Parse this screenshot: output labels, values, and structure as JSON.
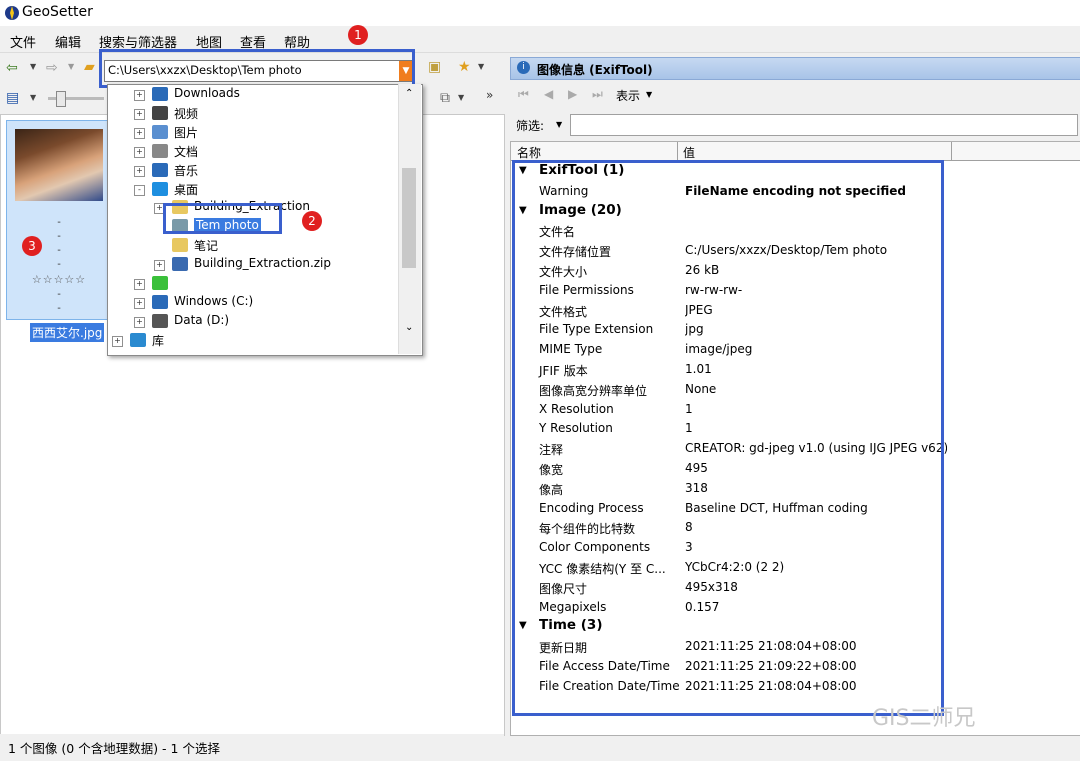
{
  "window": {
    "title": "GeoSetter"
  },
  "menu": [
    "文件",
    "编辑",
    "搜索与筛选器",
    "地图",
    "查看",
    "帮助"
  ],
  "path_combo": {
    "value": "C:\\Users\\xxzx\\Desktop\\Tem photo"
  },
  "annotations": [
    "1",
    "2",
    "3"
  ],
  "tree": [
    {
      "label": "Downloads",
      "indent": 1,
      "expander": "+"
    },
    {
      "label": "视频",
      "indent": 1,
      "expander": "+"
    },
    {
      "label": "图片",
      "indent": 1,
      "expander": "+"
    },
    {
      "label": "文档",
      "indent": 1,
      "expander": "+"
    },
    {
      "label": "音乐",
      "indent": 1,
      "expander": "+"
    },
    {
      "label": "桌面",
      "indent": 1,
      "expander": "-"
    },
    {
      "label": "Building_Extraction",
      "indent": 2,
      "expander": "+"
    },
    {
      "label": "Tem photo",
      "indent": 2,
      "expander": "",
      "selected": true
    },
    {
      "label": "笔记",
      "indent": 2,
      "expander": ""
    },
    {
      "label": "Building_Extraction.zip",
      "indent": 2,
      "expander": "+"
    },
    {
      "label": "",
      "indent": 1,
      "expander": "+"
    },
    {
      "label": "Windows (C:)",
      "indent": 1,
      "expander": "+"
    },
    {
      "label": "Data (D:)",
      "indent": 1,
      "expander": "+"
    },
    {
      "label": "库",
      "indent": 0,
      "expander": "+"
    }
  ],
  "thumbnail": {
    "lines": [
      "-",
      "-",
      "-",
      "-",
      "-",
      "-"
    ],
    "stars": "☆☆☆☆☆",
    "file_name": "西西艾尔.jpg"
  },
  "status": {
    "text": "1 个图像 (0 个含地理数据) - 1 个选择"
  },
  "info_panel": {
    "title": "图像信息 (ExifTool)",
    "display_label": "表示",
    "filter_label": "筛选:",
    "col_name": "名称",
    "col_value": "值",
    "rows": [
      {
        "group": true,
        "name": "ExifTool (1)"
      },
      {
        "name": "Warning",
        "value": "FileName encoding not specified",
        "bold": true
      },
      {
        "group": true,
        "name": "Image (20)"
      },
      {
        "name": "文件名",
        "value": ""
      },
      {
        "name": "文件存储位置",
        "value": "C:/Users/xxzx/Desktop/Tem photo"
      },
      {
        "name": "文件大小",
        "value": "26 kB"
      },
      {
        "name": "File Permissions",
        "value": "rw-rw-rw-"
      },
      {
        "name": "文件格式",
        "value": "JPEG"
      },
      {
        "name": "File Type Extension",
        "value": "jpg"
      },
      {
        "name": "MIME Type",
        "value": "image/jpeg"
      },
      {
        "name": "JFIF 版本",
        "value": "1.01"
      },
      {
        "name": "图像高宽分辨率单位",
        "value": "None"
      },
      {
        "name": "X Resolution",
        "value": "1"
      },
      {
        "name": "Y Resolution",
        "value": "1"
      },
      {
        "name": "注释",
        "value": "CREATOR: gd-jpeg v1.0 (using IJG JPEG v62),..."
      },
      {
        "name": "像宽",
        "value": "495"
      },
      {
        "name": "像高",
        "value": "318"
      },
      {
        "name": "Encoding Process",
        "value": "Baseline DCT, Huffman coding"
      },
      {
        "name": "每个组件的比特数",
        "value": "8"
      },
      {
        "name": "Color Components",
        "value": "3"
      },
      {
        "name": "YCC 像素结构(Y 至 C...",
        "value": "YCbCr4:2:0 (2 2)"
      },
      {
        "name": "图像尺寸",
        "value": "495x318"
      },
      {
        "name": "Megapixels",
        "value": "0.157"
      },
      {
        "group": true,
        "name": "Time (3)"
      },
      {
        "name": "更新日期",
        "value": "2021:11:25 21:08:04+08:00"
      },
      {
        "name": "File Access Date/Time",
        "value": "2021:11:25 21:09:22+08:00"
      },
      {
        "name": "File Creation Date/Time",
        "value": "2021:11:25 21:08:04+08:00"
      }
    ]
  },
  "watermark": "GIS二师兄",
  "colors": {
    "highlight": "#3a5fcd",
    "badge": "#e02020",
    "selection": "#3a7be0"
  }
}
